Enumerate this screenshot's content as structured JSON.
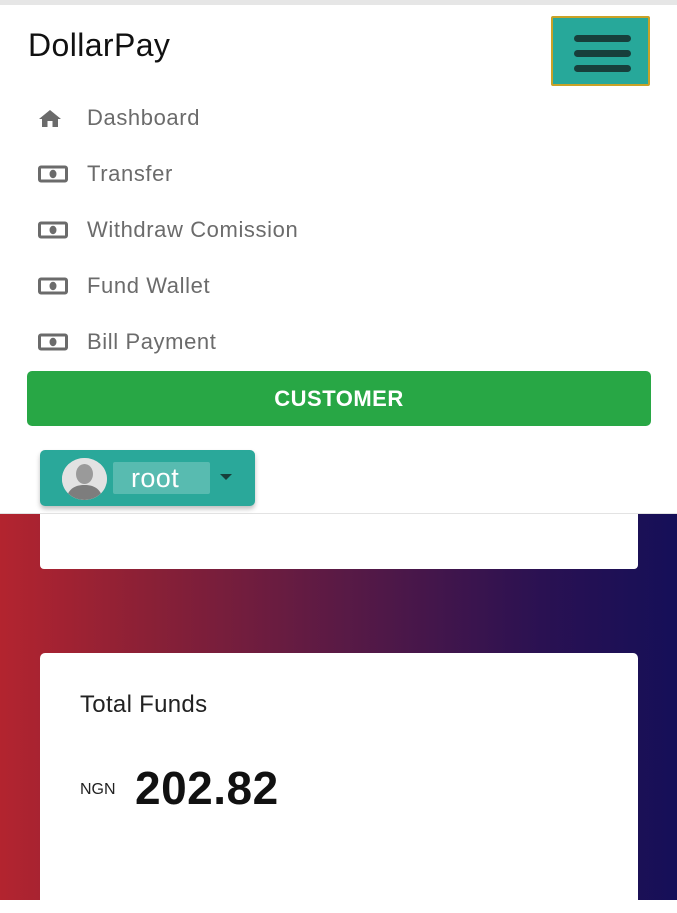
{
  "header": {
    "brand": "DollarPay",
    "menu_toggle_icon": "hamburger-menu-icon"
  },
  "nav": {
    "items": [
      {
        "label": "Dashboard",
        "icon": "home-icon"
      },
      {
        "label": "Transfer",
        "icon": "money-bill-icon"
      },
      {
        "label": "Withdraw Comission",
        "icon": "money-bill-icon"
      },
      {
        "label": "Fund Wallet",
        "icon": "money-bill-icon"
      },
      {
        "label": "Bill Payment",
        "icon": "money-bill-icon"
      }
    ],
    "role_button": "CUSTOMER",
    "user": {
      "name": "root",
      "avatar_icon": "user-avatar-icon",
      "caret_icon": "caret-down-icon"
    }
  },
  "funds": {
    "label": "Total Funds",
    "currency": "NGN",
    "amount": "202.82"
  },
  "colors": {
    "accent_teal": "#27a89a",
    "customer_green": "#28a745",
    "gradient_start": "#b3242f",
    "gradient_end": "#150f58",
    "menu_text": "#6b6b6b"
  }
}
